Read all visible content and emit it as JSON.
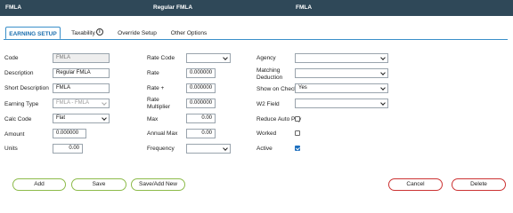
{
  "titlebar": {
    "code": "FMLA",
    "description": "Regular FMLA",
    "short": "FMLA"
  },
  "tabs": [
    {
      "label": "EARNING SETUP"
    },
    {
      "label": "Taxability"
    },
    {
      "label": "Override Setup"
    },
    {
      "label": "Other Options"
    }
  ],
  "icons": {
    "info": "info-circle-icon",
    "info_glyph": "i"
  },
  "col1": {
    "code": {
      "label": "Code",
      "value": "FMLA"
    },
    "description": {
      "label": "Description",
      "value": "Regular FMLA"
    },
    "short_description": {
      "label": "Short Description",
      "value": "FMLA"
    },
    "earning_type": {
      "label": "Earning Type",
      "value": "FMLA - FMLA"
    },
    "calc_code": {
      "label": "Calc Code",
      "value": "Flat"
    },
    "amount": {
      "label": "Amount",
      "value": "0.000000"
    },
    "units": {
      "label": "Units",
      "value": "0.00"
    }
  },
  "col2": {
    "rate_code": {
      "label": "Rate Code",
      "value": ""
    },
    "rate": {
      "label": "Rate",
      "value": "0.000000"
    },
    "rate_plus": {
      "label": "Rate +",
      "value": "0.000000"
    },
    "rate_multiplier": {
      "label1": "Rate",
      "label2": "Multiplier",
      "value": "0.000000"
    },
    "max": {
      "label": "Max",
      "value": "0.00"
    },
    "annual_max": {
      "label": "Annual Max",
      "value": "0.00"
    },
    "frequency": {
      "label": "Frequency",
      "value": ""
    }
  },
  "col3": {
    "agency": {
      "label": "Agency",
      "value": ""
    },
    "matching_deduction": {
      "label1": "Matching",
      "label2": "Deduction",
      "value": ""
    },
    "show_on_check": {
      "label": "Show on Check?",
      "value": "Yes"
    },
    "w2_field": {
      "label": "W2 Field",
      "value": ""
    },
    "reduce_auto_pay": {
      "label": "Reduce Auto Pay",
      "checked": false
    },
    "worked": {
      "label": "Worked",
      "checked": false
    },
    "active": {
      "label": "Active",
      "checked": true
    }
  },
  "buttons": {
    "add": "Add",
    "save": "Save",
    "save_add_new": "Save/Add New",
    "cancel": "Cancel",
    "delete": "Delete"
  },
  "colors": {
    "header": "#2f4858",
    "accent": "#3a8fc9",
    "green_border": "#8dbb4a",
    "red_border": "#cc3333"
  }
}
